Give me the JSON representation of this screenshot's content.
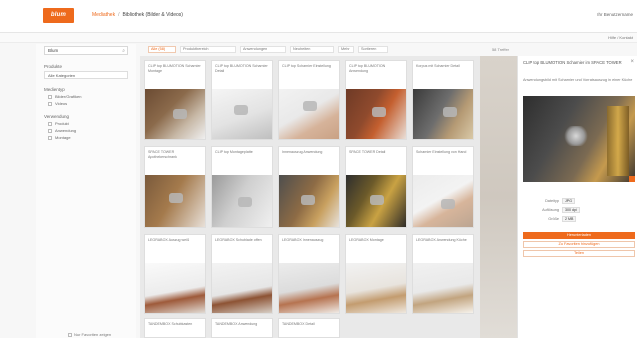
{
  "header": {
    "logo_text": "blum",
    "breadcrumb_link": "Mediathek",
    "breadcrumb_separator": "/",
    "breadcrumb_current": "Bibliothek (Bilder & Videos)",
    "right_text": "Ihr Benutzername"
  },
  "subbar": {
    "right_text": "Hilfe / Kontakt"
  },
  "sidebar": {
    "search_value": "Blum",
    "search_icon": "search-icon",
    "group_product": "Produkte",
    "product_select": "Alle Kategorien",
    "group_type": "Medientyp",
    "type_options": [
      "Bilder/Grafiken",
      "Videos"
    ],
    "group_filter": "Verwendung",
    "filter_options": [
      "Produkt",
      "Anwendung",
      "Montage"
    ],
    "footer_label": "Nur Favoriten zeigen"
  },
  "filterbar": {
    "chips": [
      "Alle (58)",
      "Produktbereich",
      "Anwendungen",
      "Neuheiten",
      "Mehr",
      "Sortieren"
    ],
    "right_text": "58 Treffer"
  },
  "cards": [
    {
      "text": "CLIP top BLUMOTION Scharnier Montage"
    },
    {
      "text": "CLIP top BLUMOTION Scharnier Detail"
    },
    {
      "text": "CLIP top Scharnier Einstellung"
    },
    {
      "text": "CLIP top BLUMOTION Anwendung"
    },
    {
      "text": "Korpus mit Scharnier Detail"
    },
    {
      "text": "SPACE TOWER Apothekerschrank"
    },
    {
      "text": "CLIP top Montageplatte"
    },
    {
      "text": "Innenauszug Anwendung"
    },
    {
      "text": "SPACE TOWER Detail"
    },
    {
      "text": "Scharnier Einstellung von Hand"
    },
    {
      "text": "LEGRABOX Auszug weiß"
    },
    {
      "text": "LEGRABOX Schublade offen"
    },
    {
      "text": "LEGRABOX Innenauszug"
    },
    {
      "text": "LEGRABOX Montage"
    },
    {
      "text": "LEGRABOX Anwendung Küche"
    },
    {
      "text": "TANDEMBOX Schubkasten"
    },
    {
      "text": "TANDEMBOX Anwendung"
    },
    {
      "text": "TANDEMBOX Detail"
    }
  ],
  "detail": {
    "title": "CLIP top BLUMOTION Scharnier im SPACE TOWER",
    "description": "Anwendungsbild mit Scharnier und Vorratsauszug in einer Küche",
    "close_icon": "close-icon",
    "meta": [
      {
        "label": "Dateityp",
        "value": "JPG"
      },
      {
        "label": "Auflösung",
        "value": "300 dpi"
      },
      {
        "label": "Größe",
        "value": "2 MB"
      }
    ],
    "download_button": "Herunterladen",
    "favorite_button": "Zu Favoriten hinzufügen",
    "share_button": "Teilen"
  },
  "colors": {
    "accent": "#ee6a1c"
  }
}
